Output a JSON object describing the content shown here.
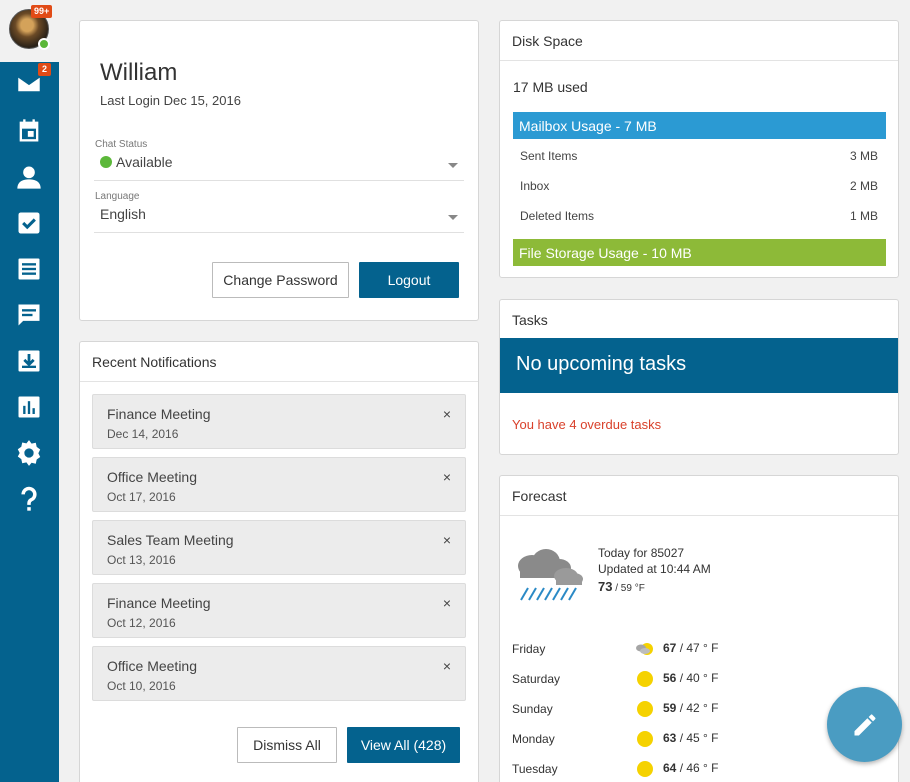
{
  "sidebar": {
    "avatar_badge": "99+",
    "mail_badge": "2",
    "items": [
      {
        "icon": "mail-icon"
      },
      {
        "icon": "calendar-icon"
      },
      {
        "icon": "contacts-icon"
      },
      {
        "icon": "tasks-icon"
      },
      {
        "icon": "notes-icon"
      },
      {
        "icon": "chat-icon"
      },
      {
        "icon": "download-icon"
      },
      {
        "icon": "reports-icon"
      },
      {
        "icon": "settings-icon"
      },
      {
        "icon": "help-icon"
      }
    ]
  },
  "profile": {
    "name": "William",
    "last_login": "Last Login Dec 15, 2016",
    "chat_status_label": "Chat Status",
    "chat_status_value": "Available",
    "language_label": "Language",
    "language_value": "English",
    "change_password": "Change Password",
    "logout": "Logout"
  },
  "notifications": {
    "title": "Recent Notifications",
    "items": [
      {
        "title": "Finance Meeting",
        "date": "Dec 14, 2016"
      },
      {
        "title": "Office Meeting",
        "date": "Oct 17, 2016"
      },
      {
        "title": "Sales Team Meeting",
        "date": "Oct 13, 2016"
      },
      {
        "title": "Finance Meeting",
        "date": "Oct 12, 2016"
      },
      {
        "title": "Office Meeting",
        "date": "Oct 10, 2016"
      }
    ],
    "close_glyph": "×",
    "dismiss_all": "Dismiss All",
    "view_all": "View All (428)"
  },
  "disk": {
    "title": "Disk Space",
    "used": "17 MB used",
    "mailbox_label": "Mailbox Usage - 7 MB",
    "mailbox_color": "#2b9ad3",
    "rows": [
      {
        "label": "Sent Items",
        "size": "3 MB"
      },
      {
        "label": "Inbox",
        "size": "2 MB"
      },
      {
        "label": "Deleted Items",
        "size": "1 MB"
      }
    ],
    "file_label": "File Storage Usage - 10 MB",
    "file_color": "#8dba38"
  },
  "tasks": {
    "title": "Tasks",
    "banner": "No upcoming tasks",
    "overdue": "You have 4 overdue tasks"
  },
  "forecast": {
    "title": "Forecast",
    "today_for": "Today for 85027",
    "updated": "Updated at 10:44 AM",
    "current_hi": "73",
    "current_lo": " / 59 °F",
    "days": [
      {
        "day": "Friday",
        "hi": "67",
        "lo": " / 47 ° F",
        "icon": "partly-sunny-icon"
      },
      {
        "day": "Saturday",
        "hi": "56",
        "lo": " / 40 ° F",
        "icon": "sun-icon"
      },
      {
        "day": "Sunday",
        "hi": "59",
        "lo": " / 42 ° F",
        "icon": "sun-icon"
      },
      {
        "day": "Monday",
        "hi": "63",
        "lo": " / 45 ° F",
        "icon": "sun-icon"
      },
      {
        "day": "Tuesday",
        "hi": "64",
        "lo": " / 46 ° F",
        "icon": "sun-icon"
      }
    ]
  },
  "colors": {
    "primary": "#04628e",
    "available": "#5cb83a",
    "overdue": "#d9412b"
  }
}
